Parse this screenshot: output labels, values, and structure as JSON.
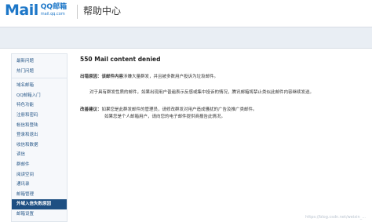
{
  "header": {
    "logo_mail": "Mail",
    "logo_qq": "QQ邮箱",
    "logo_url": "mail.qq.com",
    "title": "帮助中心"
  },
  "sidebar": {
    "groups": [
      {
        "items": [
          {
            "label": "最新问题"
          },
          {
            "label": "热门问题"
          }
        ]
      },
      {
        "items": [
          {
            "label": "域名邮箱"
          },
          {
            "label": "QQ邮箱入门"
          },
          {
            "label": "特色功能"
          },
          {
            "label": "注册和密码"
          },
          {
            "label": "帐信和登陆"
          },
          {
            "label": "登录和退出"
          },
          {
            "label": "收信和数据"
          },
          {
            "label": "读信"
          },
          {
            "label": "群邮件"
          },
          {
            "label": "阅读空间"
          },
          {
            "label": "通讯录"
          },
          {
            "label": "邮箱管理"
          },
          {
            "label": "外域入信失败原因",
            "active": true
          },
          {
            "label": "邮箱设置"
          }
        ]
      }
    ]
  },
  "main": {
    "title": "550 Mail content denied",
    "reason_label": "出错原因：",
    "reason_text_bold": "该邮件内容",
    "reason_text": "涉嫌大量群发，并且被多数用户投诉为垃圾邮件。",
    "reason_text2": "对于具有群发性质的邮件，如果出现用户普遍表示反感或集中投诉的情况，腾讯邮箱将禁止类似此邮件内容继续发送。",
    "suggest_label": "改善建议：",
    "suggest_text": "如果您是此群发邮件的管理员，请修改群发对用户造成骚扰的广告及推广类邮件。",
    "suggest_text2": "如果您是个人邮箱用户，请向您的电子邮件提供商报告此情况。"
  },
  "watermark": "https://blog.csdn.net/weixin_..."
}
